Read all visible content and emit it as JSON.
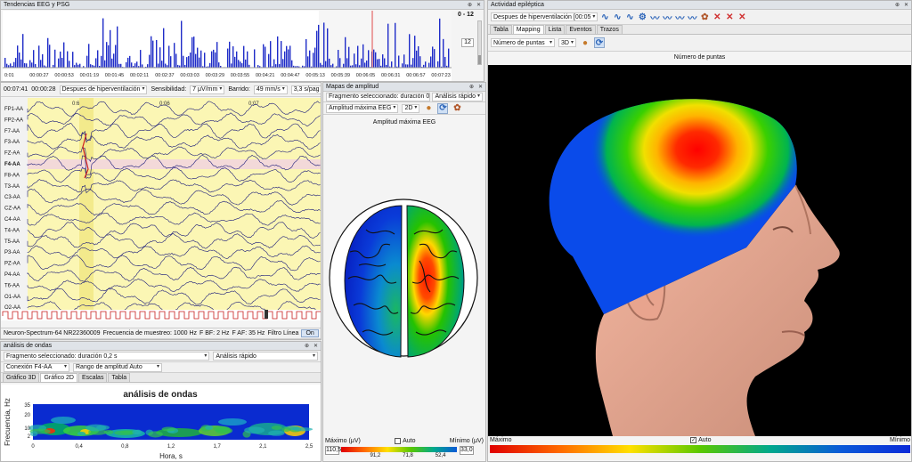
{
  "trends": {
    "title": "Tendencias EEG y PSG",
    "range": "0 - 12",
    "value": "12",
    "times": [
      "0:01",
      "00:00:27",
      "00:00:53",
      "00:01:19",
      "00:01:45",
      "00:02:11",
      "00:02:37",
      "00:03:03",
      "00:03:29",
      "00:03:55",
      "00:04:21",
      "00:04:47",
      "00:05:13",
      "00:05:39",
      "00:06:05",
      "00:06:31",
      "00:06:57",
      "00:07:23"
    ]
  },
  "eeg": {
    "time1": "00:07:41",
    "time2": "00:00:28",
    "state": "Despues de hiperventilación",
    "sens_label": "Sensibilidad:",
    "sens": "7 μV/mm",
    "sweep_label": "Barrido:",
    "sweep": "49 mm/s",
    "speed": "3,3 s/pag",
    "channels": [
      "FP1-AA",
      "FP2-AA",
      "F7-AA",
      "F3-AA",
      "FZ-AA",
      "F4-AA",
      "F8-AA",
      "T3-AA",
      "C3-AA",
      "CZ-AA",
      "C4-AA",
      "T4-AA",
      "T5-AA",
      "P3-AA",
      "PZ-AA",
      "P4-AA",
      "T6-AA",
      "O1-AA",
      "O2-AA"
    ],
    "selected": "F4-AA",
    "marks": [
      "0:6",
      "0:06",
      "0:07"
    ],
    "device": "Neuron-Spectrum-64 NR22360009",
    "freq": "Frecuencia de muestreo: 1000 Hz",
    "fbf": "F BF: 2 Hz",
    "faf": "F AF: 35 Hz",
    "filter": "Filtro Línea",
    "on": "On"
  },
  "waves": {
    "title": "análisis de ondas",
    "fragment": "Fragmento seleccionado: duración 0,2 s",
    "quick": "Análisis rápido",
    "conn": "Conexión F4-AA",
    "amp": "Rango de amplitud Auto",
    "tabs": [
      "Gráfico 3D",
      "Gráfico 2D",
      "Escalas",
      "Tabla"
    ],
    "active_tab": 1,
    "plot_title": "análisis de ondas",
    "ylabel": "Frecuencia, Hz",
    "xlabel": "Hora, s",
    "yticks": [
      "35",
      "20",
      "10",
      "2"
    ],
    "xticks": [
      "0",
      "0,4",
      "0,8",
      "1,2",
      "1,7",
      "2,1",
      "2,5"
    ]
  },
  "amp": {
    "title": "Mapas de amplitud",
    "fragment": "Fragmento seleccionado: duración 0,2 s",
    "quick": "Análisis rápido",
    "mode": "Amplitud máxima EEG",
    "dim": "2D",
    "map_title": "Amplitud máxima EEG",
    "max_label": "Máximo (μV)",
    "auto": "Auto",
    "min_label": "Mínimo (μV)",
    "max_val": "110,5",
    "min_val": "33,0",
    "scale": [
      "91,2",
      "71,8",
      "52,4"
    ]
  },
  "epi": {
    "title": "Actividad epiléptica",
    "state": "Despues de hiperventilación [00:05",
    "tabs": [
      "Tabla",
      "Mapping",
      "Lista",
      "Eventos",
      "Trazos"
    ],
    "active_tab": 1,
    "measure": "Número de puntas",
    "dim": "3D",
    "map_title": "Número de puntas",
    "max": "Máximo",
    "auto": "Auto",
    "min": "Mínimo"
  },
  "colors": {
    "accent": "#2a63b8",
    "bars": "#1f2cc8",
    "wave": "#1a1a7a",
    "highlight": "#fbf6b4",
    "select": "#f3d9d9"
  }
}
